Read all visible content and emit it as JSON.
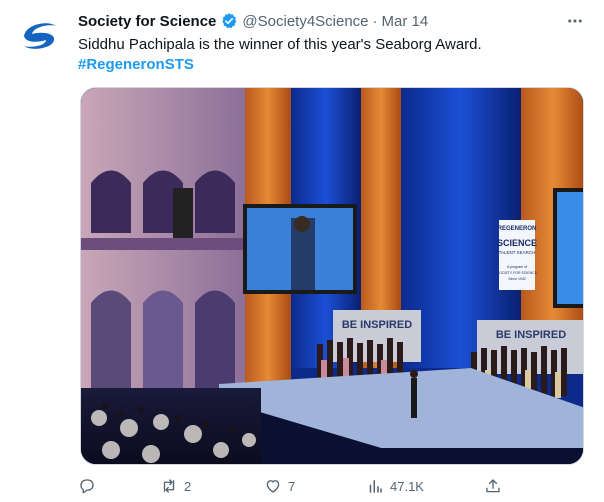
{
  "tweet": {
    "author_name": "Society for Science",
    "handle": "@Society4Science",
    "separator": "·",
    "date": "Mar 14",
    "text": "Siddhu Pachipala is the winner of this year's Seaborg Award.",
    "hashtag": "#RegeneronSTS",
    "verified": true
  },
  "photo": {
    "banner_left": "BE INSPIRED",
    "banner_right": "BE INSPIRED",
    "sign_top": "REGENERON",
    "sign_mid": "SCIENCE",
    "sign_sub": "TALENT SEARCH",
    "sign_small1": "A program of",
    "sign_small2": "SOCIETY FOR SCIENCE",
    "sign_small3": "Since 1942"
  },
  "actions": {
    "reply_count": "",
    "retweet_count": "2",
    "like_count": "7",
    "views_count": "47.1K"
  },
  "colors": {
    "brand_blue": "#1d9bf0",
    "text_primary": "#0f1419",
    "text_secondary": "#536471",
    "logo_blue": "#1565c0"
  },
  "icons": [
    "society-logo-icon",
    "verified-badge-icon",
    "more-icon",
    "reply-icon",
    "retweet-icon",
    "like-icon",
    "views-icon",
    "share-icon"
  ]
}
